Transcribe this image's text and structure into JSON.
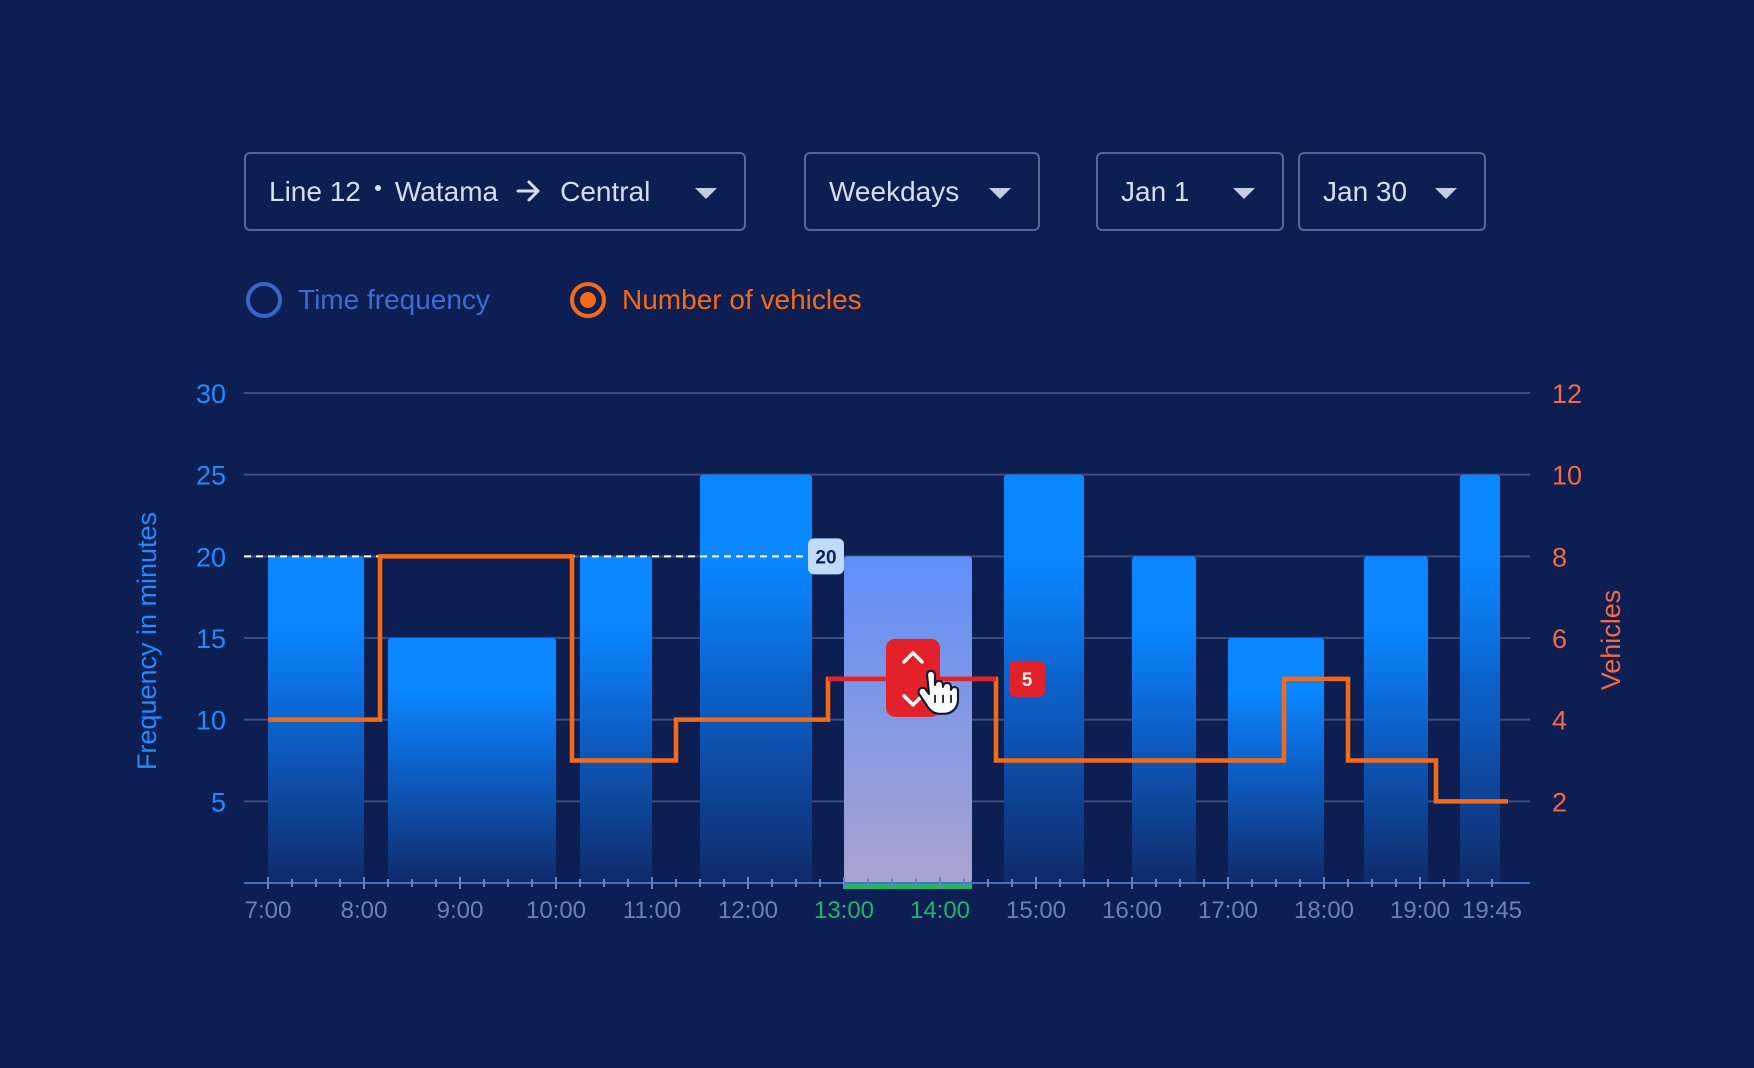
{
  "filters": {
    "line": {
      "line_label": "Line 12",
      "from": "Watama",
      "to": "Central"
    },
    "days": "Weekdays",
    "start_date": "Jan 1",
    "end_date": "Jan 30"
  },
  "modes": {
    "time_frequency": {
      "label": "Time frequency",
      "selected": false
    },
    "number_of_vehicles": {
      "label": "Number of vehicles",
      "selected": true
    }
  },
  "colors": {
    "background": "#0d1f52",
    "bar": "#0a86ff",
    "selected_bar": "#6f8ef0",
    "vehicles_line": "#f46a16",
    "edit_line": "#e3212a",
    "left_axis": "#1f8bff",
    "right_axis": "#f06a45",
    "selected_tick": "#25b36b"
  },
  "chart_data": {
    "type": "bar",
    "xlabel": "",
    "ylabel": "Frequency in minutes",
    "y2label": "Vehicles",
    "ylim": [
      0,
      30
    ],
    "y2lim": [
      0,
      12
    ],
    "yticks": [
      5,
      10,
      15,
      20,
      25,
      30
    ],
    "y2ticks": [
      2,
      4,
      6,
      8,
      10,
      12
    ],
    "xtick_labels": [
      "7:00",
      "8:00",
      "9:00",
      "10:00",
      "11:00",
      "12:00",
      "13:00",
      "14:00",
      "15:00",
      "16:00",
      "17:00",
      "18:00",
      "19:00",
      "19:45"
    ],
    "selected_ticks": [
      "13:00",
      "14:00"
    ],
    "frequency_bars": [
      {
        "start": "7:00",
        "end": "8:00",
        "value": 20
      },
      {
        "start": "8:15",
        "end": "10:00",
        "value": 15
      },
      {
        "start": "10:15",
        "end": "11:00",
        "value": 20
      },
      {
        "start": "11:30",
        "end": "12:40",
        "value": 25
      },
      {
        "start": "13:00",
        "end": "14:20",
        "value": 20,
        "selected": true
      },
      {
        "start": "14:40",
        "end": "15:30",
        "value": 25
      },
      {
        "start": "16:00",
        "end": "16:40",
        "value": 20
      },
      {
        "start": "17:00",
        "end": "18:00",
        "value": 15
      },
      {
        "start": "18:25",
        "end": "19:05",
        "value": 20
      },
      {
        "start": "19:25",
        "end": "19:50",
        "value": 25
      }
    ],
    "vehicles_series": {
      "step_times": [
        "7:00",
        "8:10",
        "10:10",
        "11:15",
        "12:50",
        "14:35",
        "17:35",
        "18:15",
        "19:10",
        "19:55"
      ],
      "step_values": [
        4,
        8,
        3,
        4,
        5,
        3,
        5,
        3,
        2,
        2
      ]
    },
    "annotations": {
      "frequency_value": "20",
      "vehicles_value": "5"
    }
  }
}
